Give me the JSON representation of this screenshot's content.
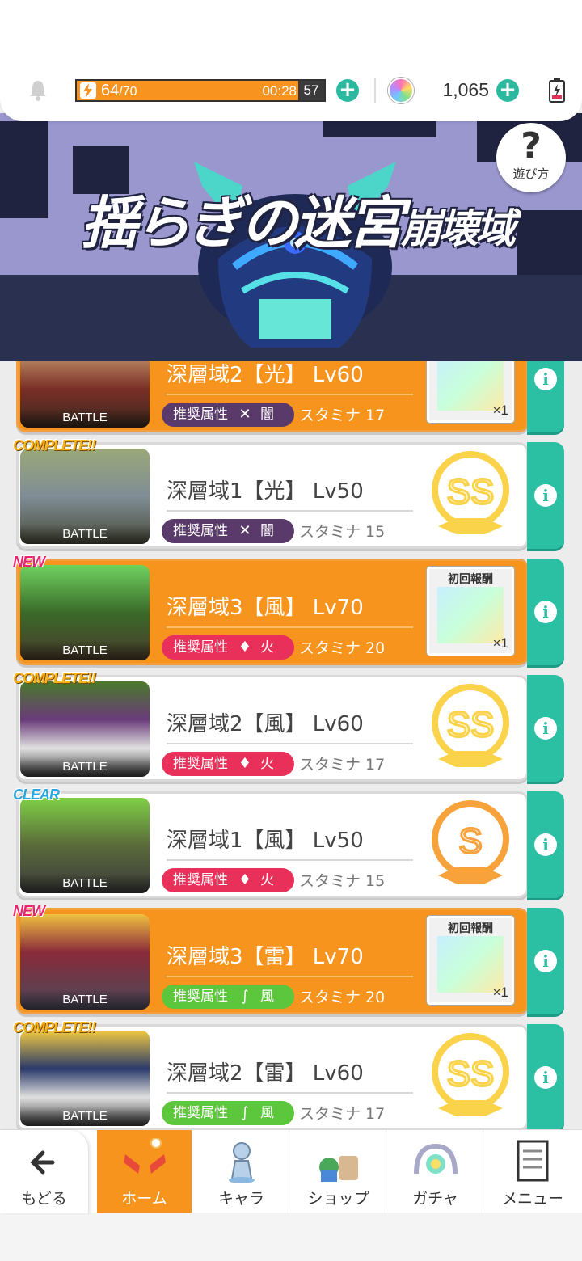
{
  "status": {
    "stamina_current": "64",
    "stamina_max": "/70",
    "stamina_timer": "00:28",
    "stamina_timer_tail": "57",
    "gems": "1,065"
  },
  "banner": {
    "title_1": "揺らぎの迷宮",
    "title_2": "崩壊域",
    "help_label": "遊び方"
  },
  "rows": [
    {
      "tag": "",
      "name": "深層域2【光】 Lv60",
      "attr_label": "推奨属性",
      "attr_elem": "闇",
      "stamina": "スタミナ 17",
      "reward_caption": "",
      "reward_qty": "×1",
      "rank": "",
      "battle": "BATTLE"
    },
    {
      "tag": "COMPLETE!!",
      "name": "深層域1【光】 Lv50",
      "attr_label": "推奨属性",
      "attr_elem": "闇",
      "stamina": "スタミナ 15",
      "reward_caption": "",
      "reward_qty": "",
      "rank": "SS",
      "battle": "BATTLE"
    },
    {
      "tag": "NEW",
      "name": "深層域3【風】 Lv70",
      "attr_label": "推奨属性",
      "attr_elem": "火",
      "stamina": "スタミナ 20",
      "reward_caption": "初回報酬",
      "reward_qty": "×1",
      "rank": "",
      "battle": "BATTLE"
    },
    {
      "tag": "COMPLETE!!",
      "name": "深層域2【風】 Lv60",
      "attr_label": "推奨属性",
      "attr_elem": "火",
      "stamina": "スタミナ 17",
      "reward_caption": "",
      "reward_qty": "",
      "rank": "SS",
      "battle": "BATTLE"
    },
    {
      "tag": "CLEAR",
      "name": "深層域1【風】 Lv50",
      "attr_label": "推奨属性",
      "attr_elem": "火",
      "stamina": "スタミナ 15",
      "reward_caption": "",
      "reward_qty": "",
      "rank": "S",
      "battle": "BATTLE"
    },
    {
      "tag": "NEW",
      "name": "深層域3【雷】 Lv70",
      "attr_label": "推奨属性",
      "attr_elem": "風",
      "stamina": "スタミナ 20",
      "reward_caption": "初回報酬",
      "reward_qty": "×1",
      "rank": "",
      "battle": "BATTLE"
    },
    {
      "tag": "COMPLETE!!",
      "name": "深層域2【雷】 Lv60",
      "attr_label": "推奨属性",
      "attr_elem": "風",
      "stamina": "スタミナ 17",
      "reward_caption": "",
      "reward_qty": "",
      "rank": "SS",
      "battle": "BATTLE"
    }
  ],
  "nav": {
    "back": "もどる",
    "home": "ホーム",
    "chara": "キャラ",
    "shop": "ショップ",
    "gacha": "ガチャ",
    "menu": "メニュー"
  },
  "colors": {
    "accent_orange": "#f7941d",
    "accent_teal": "#2bbfa4",
    "pill_dark": "#5a3a6a",
    "pill_fire": "#e8305a",
    "pill_wind": "#5cc63c"
  }
}
